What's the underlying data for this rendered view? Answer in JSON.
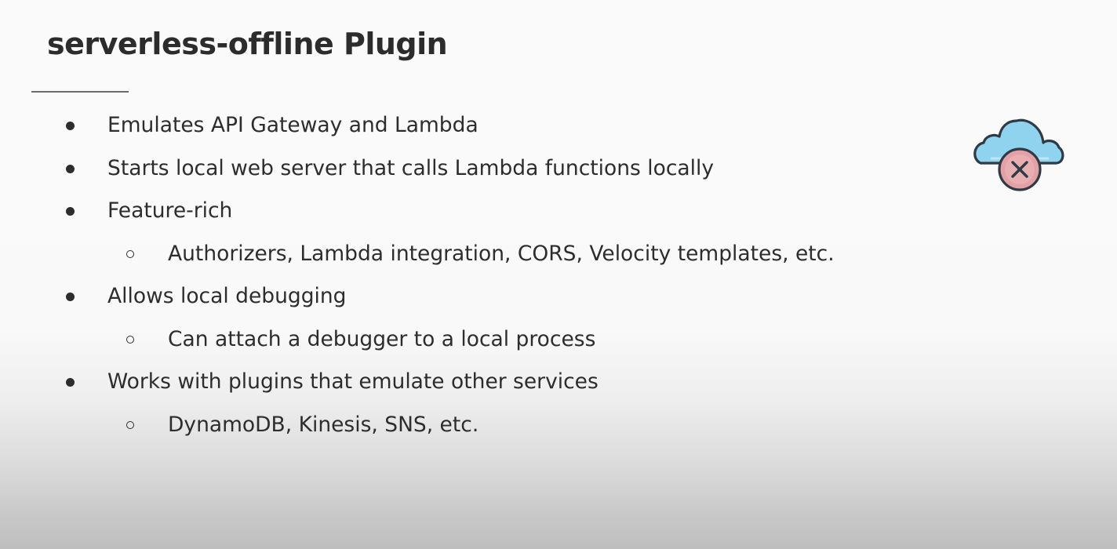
{
  "slide": {
    "title": "serverless-offline Plugin",
    "bullets": [
      {
        "level": 1,
        "text": "Emulates API Gateway and Lambda"
      },
      {
        "level": 1,
        "text": "Starts local web server that calls Lambda functions locally"
      },
      {
        "level": 1,
        "text": "Feature-rich"
      },
      {
        "level": 2,
        "text": "Authorizers, Lambda integration, CORS, Velocity templates, etc."
      },
      {
        "level": 1,
        "text": "Allows local debugging"
      },
      {
        "level": 2,
        "text": "Can attach a debugger to a local process"
      },
      {
        "level": 1,
        "text": "Works with plugins that emulate other services"
      },
      {
        "level": 2,
        "text": "DynamoDB, Kinesis, SNS, etc."
      }
    ],
    "icon": "cloud-offline-icon"
  },
  "colors": {
    "text": "#2d2d2d",
    "cloud_fill": "#8fd3ee",
    "badge_fill": "#e3a0a5",
    "outline": "#2e3a44"
  }
}
